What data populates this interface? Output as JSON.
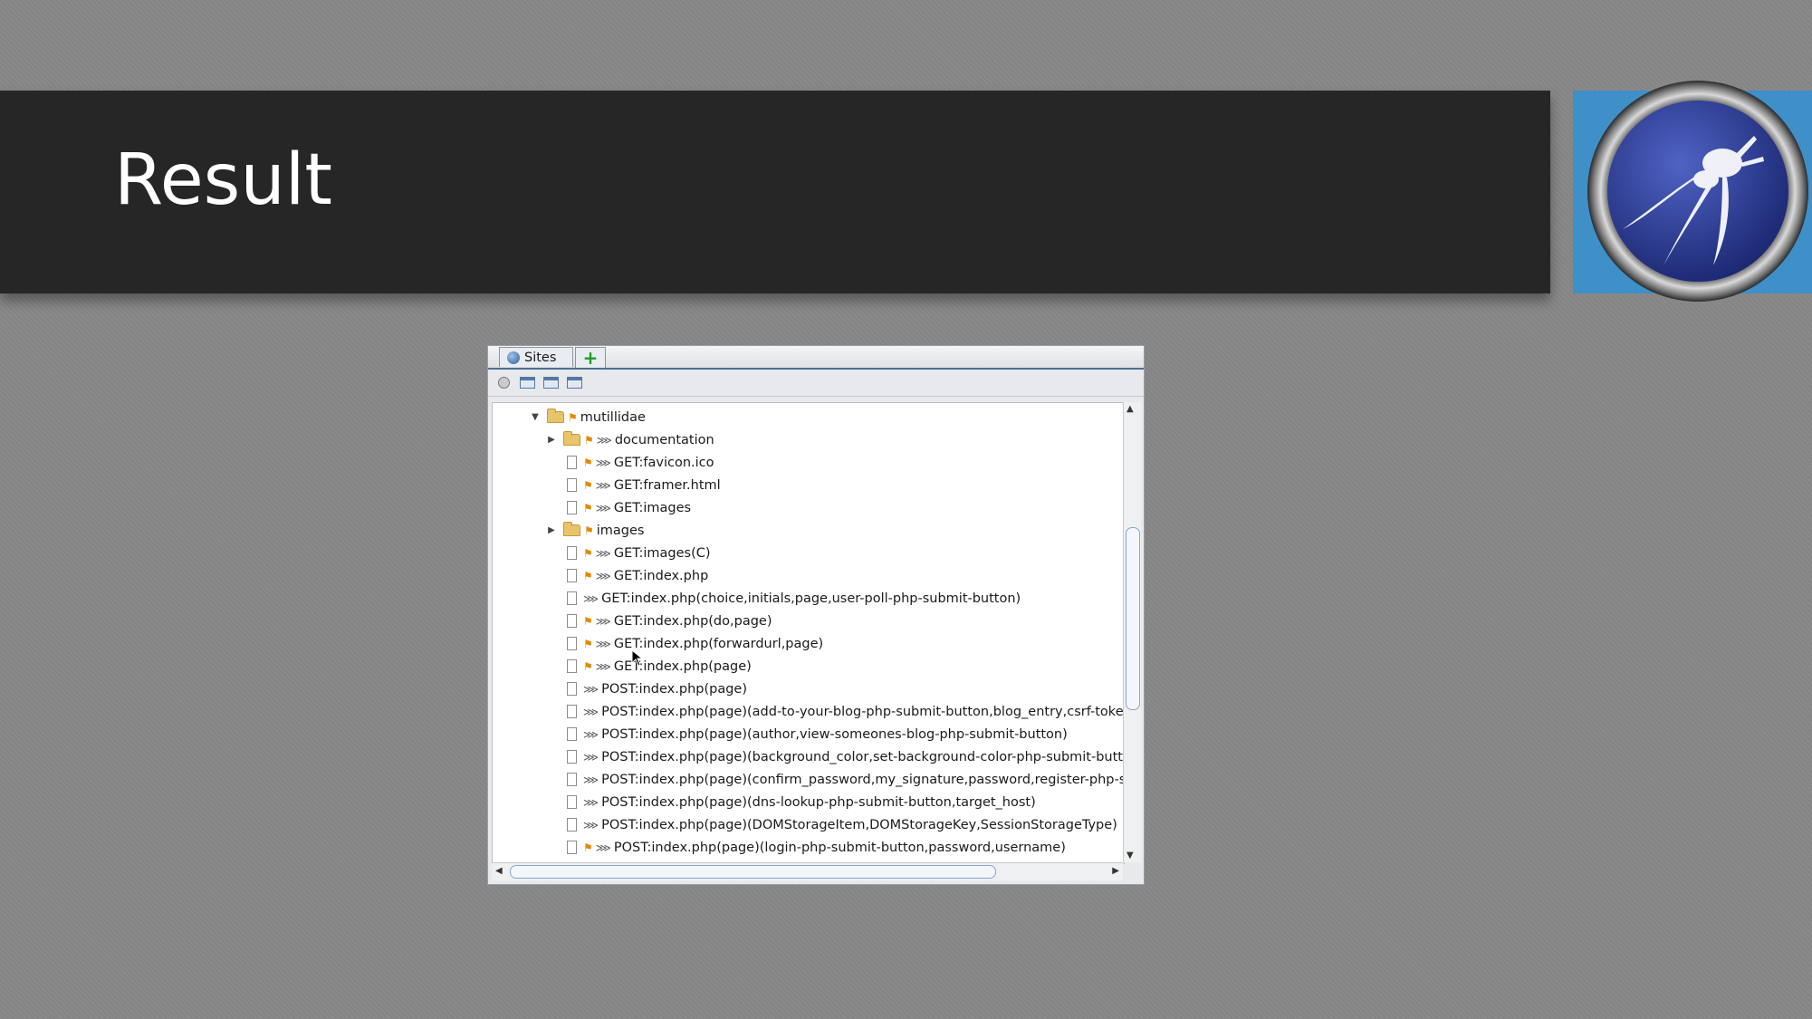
{
  "slide": {
    "title": "Result"
  },
  "zap": {
    "tabs": [
      {
        "label": "Sites",
        "icon": "globe-icon"
      },
      {
        "label": "",
        "icon": "plus-icon"
      }
    ],
    "toolbar": [
      {
        "icon": "circle-icon"
      },
      {
        "icon": "new-context-icon"
      },
      {
        "icon": "window-icon"
      },
      {
        "icon": "window-icon"
      }
    ],
    "tree": [
      {
        "label": "mutillidae",
        "level": 0,
        "expander": "expanded",
        "type": "folder",
        "flag": true,
        "spider": false
      },
      {
        "label": "documentation",
        "level": 1,
        "expander": "collapsed",
        "type": "folder",
        "flag": true,
        "spider": true
      },
      {
        "label": "GET:favicon.ico",
        "level": 1,
        "expander": "none",
        "type": "page",
        "flag": true,
        "spider": true
      },
      {
        "label": "GET:framer.html",
        "level": 1,
        "expander": "none",
        "type": "page",
        "flag": true,
        "spider": true
      },
      {
        "label": "GET:images",
        "level": 1,
        "expander": "none",
        "type": "page",
        "flag": true,
        "spider": true
      },
      {
        "label": "images",
        "level": 1,
        "expander": "collapsed",
        "type": "folder",
        "flag": true,
        "spider": false
      },
      {
        "label": "GET:images(C)",
        "level": 1,
        "expander": "none",
        "type": "page",
        "flag": true,
        "spider": true
      },
      {
        "label": "GET:index.php",
        "level": 1,
        "expander": "none",
        "type": "page",
        "flag": true,
        "spider": true
      },
      {
        "label": "GET:index.php(choice,initials,page,user-poll-php-submit-button)",
        "level": 1,
        "expander": "none",
        "type": "page",
        "flag": false,
        "spider": true
      },
      {
        "label": "GET:index.php(do,page)",
        "level": 1,
        "expander": "none",
        "type": "page",
        "flag": true,
        "spider": true
      },
      {
        "label": "GET:index.php(forwardurl,page)",
        "level": 1,
        "expander": "none",
        "type": "page",
        "flag": true,
        "spider": true
      },
      {
        "label": "GET:index.php(page)",
        "level": 1,
        "expander": "none",
        "type": "page",
        "flag": true,
        "spider": true
      },
      {
        "label": "POST:index.php(page)",
        "level": 1,
        "expander": "none",
        "type": "page",
        "flag": false,
        "spider": true
      },
      {
        "label": "POST:index.php(page)(add-to-your-blog-php-submit-button,blog_entry,csrf-token)",
        "level": 1,
        "expander": "none",
        "type": "page",
        "flag": false,
        "spider": true
      },
      {
        "label": "POST:index.php(page)(author,view-someones-blog-php-submit-button)",
        "level": 1,
        "expander": "none",
        "type": "page",
        "flag": false,
        "spider": true
      },
      {
        "label": "POST:index.php(page)(background_color,set-background-color-php-submit-button)",
        "level": 1,
        "expander": "none",
        "type": "page",
        "flag": false,
        "spider": true
      },
      {
        "label": "POST:index.php(page)(confirm_password,my_signature,password,register-php-subm",
        "level": 1,
        "expander": "none",
        "type": "page",
        "flag": false,
        "spider": true
      },
      {
        "label": "POST:index.php(page)(dns-lookup-php-submit-button,target_host)",
        "level": 1,
        "expander": "none",
        "type": "page",
        "flag": false,
        "spider": true
      },
      {
        "label": "POST:index.php(page)(DOMStorageItem,DOMStorageKey,SessionStorageType)",
        "level": 1,
        "expander": "none",
        "type": "page",
        "flag": false,
        "spider": true
      },
      {
        "label": "POST:index.php(page)(login-php-submit-button,password,username)",
        "level": 1,
        "expander": "none",
        "type": "page",
        "flag": true,
        "spider": true
      }
    ]
  },
  "colors": {
    "background": "#878787",
    "title_bar": "#262626",
    "logo_box": "#3f8fc8",
    "flag": "#e08a00",
    "folder": "#e9c46a"
  }
}
